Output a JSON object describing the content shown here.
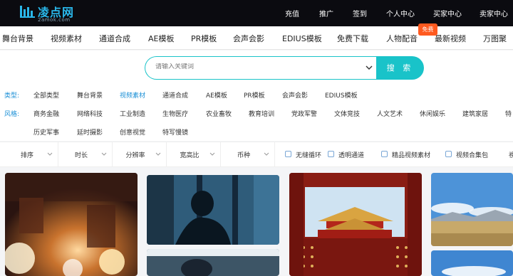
{
  "header": {
    "logo_text": "凌点网",
    "logo_sub": "2amok.com",
    "links": [
      "充值",
      "推广",
      "签到",
      "个人中心",
      "买家中心",
      "卖家中心"
    ]
  },
  "category_nav": {
    "items": [
      "舞台背景",
      "视频素材",
      "通道合成",
      "AE模板",
      "PR模板",
      "会声会影",
      "EDIUS模板",
      "免费下载",
      "人物配音",
      "最新视频",
      "万图聚"
    ],
    "badge": "免费"
  },
  "search": {
    "placeholder": "请输入关键词",
    "button_label": "搜 索"
  },
  "filters": {
    "type_label": "类型:",
    "types": [
      "全部类型",
      "舞台背景",
      "视频素材",
      "通道合成",
      "AE模板",
      "PR模板",
      "会声会影",
      "EDIUS模板"
    ],
    "active_type": "视频素材",
    "style_label": "风格:",
    "styles_row1": [
      "商务金融",
      "网络科技",
      "工业制造",
      "生物医疗",
      "农业畜牧",
      "教育培训",
      "党政军警",
      "文体竞技",
      "人文艺术",
      "休闲娱乐",
      "建筑家居",
      "特"
    ],
    "styles_row2": [
      "历史军事",
      "延时摄影",
      "创意视觉",
      "特写慢镜"
    ]
  },
  "sortbar": {
    "sorts": [
      "排序",
      "时长",
      "分辨率",
      "宽高比",
      "币种"
    ],
    "checks": [
      "无缝循环",
      "透明通道",
      "精品视频素材",
      "视频合集包"
    ],
    "tail": "視"
  },
  "colors": {
    "accent": "#19c3c9",
    "link_blue": "#1a8fd6",
    "badge": "#ff5a1f",
    "topbar": "#0b0b10"
  }
}
